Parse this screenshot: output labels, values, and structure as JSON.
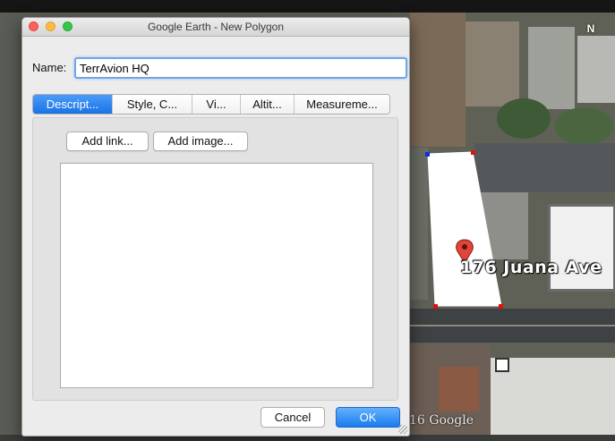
{
  "window": {
    "title": "Google Earth - New Polygon"
  },
  "form": {
    "name_label": "Name:",
    "name_value": "TerrAvion HQ"
  },
  "tabs": [
    {
      "label": "Descript...",
      "active": true
    },
    {
      "label": "Style, C...",
      "active": false
    },
    {
      "label": "Vi...",
      "active": false
    },
    {
      "label": "Altit...",
      "active": false
    },
    {
      "label": "Measureme...",
      "active": false
    }
  ],
  "panel": {
    "add_link_label": "Add link...",
    "add_image_label": "Add image...",
    "description_value": ""
  },
  "footer": {
    "cancel_label": "Cancel",
    "ok_label": "OK"
  },
  "map": {
    "street_label": "176 Juana Ave",
    "copyright": "16 Google",
    "compass_label": "N"
  },
  "colors": {
    "accent": "#1a72e6",
    "close_light": "#fc605c",
    "minimize_light": "#fdbc40",
    "zoom_light": "#34c84a",
    "polygon_fill": "#ffffff",
    "vertex_red": "#e01010",
    "vertex_blue": "#1030e0",
    "placemark": "#e0443a"
  }
}
